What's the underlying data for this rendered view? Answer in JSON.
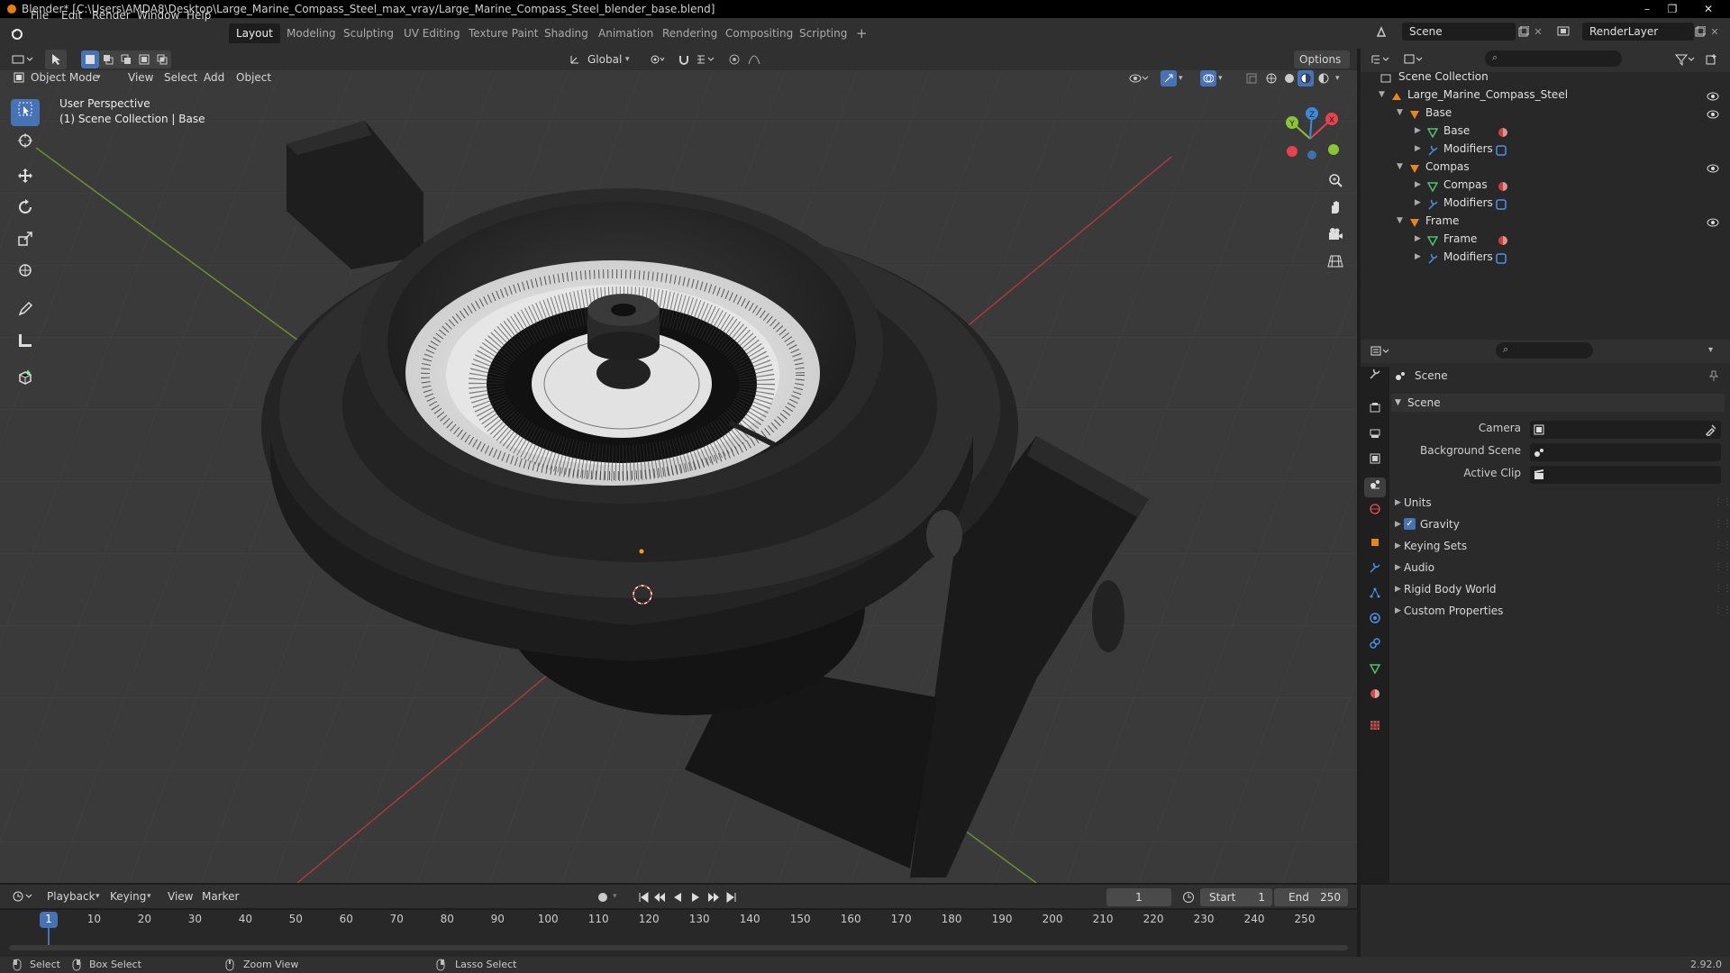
{
  "titlebar": {
    "title": "Blender* [C:\\Users\\AMDA8\\Desktop\\Large_Marine_Compass_Steel_max_vray/Large_Marine_Compass_Steel_blender_base.blend]",
    "minimize": "–",
    "maximize": "❐",
    "close": "✕"
  },
  "menus": [
    "File",
    "Edit",
    "Render",
    "Window",
    "Help"
  ],
  "workspaces": [
    "Layout",
    "Modeling",
    "Sculpting",
    "UV Editing",
    "Texture Paint",
    "Shading",
    "Animation",
    "Rendering",
    "Compositing",
    "Scripting"
  ],
  "add_workspace": "+",
  "scene_selector": "Scene",
  "view_layer": "RenderLayer",
  "viewport": {
    "orientation": "Global",
    "options": "Options",
    "mode": "Object Mode",
    "menus": [
      "View",
      "Select",
      "Add",
      "Object"
    ],
    "overlay_line1": "User Perspective",
    "overlay_line2": "(1) Scene Collection | Base",
    "gizmo": {
      "x": "X",
      "y": "Y",
      "z": "Z"
    }
  },
  "outliner": {
    "root": "Scene Collection",
    "rows": [
      {
        "label": "Large_Marine_Compass_Steel",
        "depth": 1,
        "kind": "collection",
        "expanded": true,
        "eye": true
      },
      {
        "label": "Base",
        "depth": 2,
        "kind": "object",
        "expanded": true,
        "eye": true
      },
      {
        "label": "Base",
        "depth": 3,
        "kind": "mesh",
        "expanded": false
      },
      {
        "label": "Modifiers",
        "depth": 3,
        "kind": "modifiers",
        "expanded": false
      },
      {
        "label": "Compas",
        "depth": 2,
        "kind": "object",
        "expanded": true,
        "eye": true
      },
      {
        "label": "Compas",
        "depth": 3,
        "kind": "mesh",
        "expanded": false
      },
      {
        "label": "Modifiers",
        "depth": 3,
        "kind": "modifiers",
        "expanded": false
      },
      {
        "label": "Frame",
        "depth": 2,
        "kind": "object",
        "expanded": true,
        "eye": true
      },
      {
        "label": "Frame",
        "depth": 3,
        "kind": "mesh",
        "expanded": false
      },
      {
        "label": "Modifiers",
        "depth": 3,
        "kind": "modifiers",
        "expanded": false
      }
    ]
  },
  "properties": {
    "context": "Scene",
    "panel_title": "Scene",
    "camera_label": "Camera",
    "background_scene_label": "Background Scene",
    "active_clip_label": "Active Clip",
    "subpanels": [
      "Units",
      "Gravity",
      "Keying Sets",
      "Audio",
      "Rigid Body World",
      "Custom Properties"
    ],
    "gravity_checked": true
  },
  "timeline": {
    "menus": [
      "Playback",
      "Keying",
      "View",
      "Marker"
    ],
    "current_frame": "1",
    "start_label": "Start",
    "start": "1",
    "end_label": "End",
    "end": "250",
    "ticks": [
      "1",
      "10",
      "20",
      "30",
      "40",
      "50",
      "60",
      "70",
      "80",
      "90",
      "100",
      "110",
      "120",
      "130",
      "140",
      "150",
      "160",
      "170",
      "180",
      "190",
      "200",
      "210",
      "220",
      "230",
      "240",
      "250"
    ]
  },
  "statusbar": {
    "select": "Select",
    "box_select": "Box Select",
    "zoom_view": "Zoom View",
    "lasso_select": "Lasso Select",
    "version": "2.92.0"
  },
  "colors": {
    "accent": "#4772b3",
    "brand": "#e87d0d",
    "axis_x": "#e8414f",
    "axis_y": "#8bc435",
    "axis_z": "#3d89dc"
  }
}
